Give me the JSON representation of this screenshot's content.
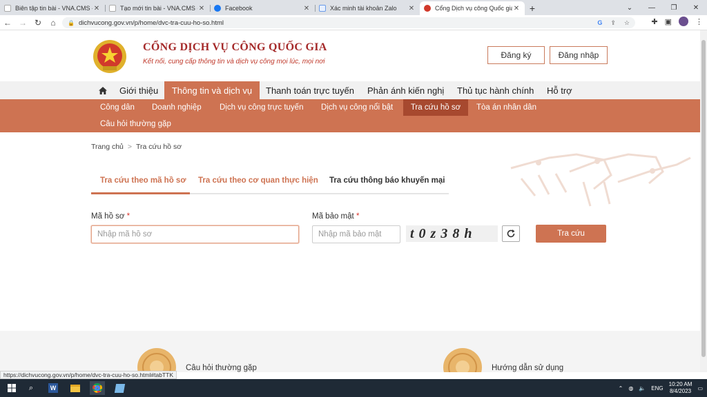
{
  "browser": {
    "tabs": [
      {
        "title": "Biên tập tin bài - VNA.CMS - BNI",
        "favicon_color": "#ffffff"
      },
      {
        "title": "Tạo mới tin bài - VNA.CMS - BNI",
        "favicon_color": "#ffffff"
      },
      {
        "title": "Facebook",
        "favicon_color": "#1877f2"
      },
      {
        "title": "Xác minh tài khoản Zalo",
        "favicon_color": "#e7f0ff"
      },
      {
        "title": "Cổng Dịch vụ công Quốc gia",
        "favicon_color": "#d1392b"
      }
    ],
    "address": "dichvucong.gov.vn/p/home/dvc-tra-cuu-ho-so.html",
    "status_url": "https://dichvucong.gov.vn/p/home/dvc-tra-cuu-ho-so.html#tabTTK"
  },
  "header": {
    "title": "CỔNG DỊCH VỤ CÔNG QUỐC GIA",
    "subtitle": "Kết nối, cung cấp thông tin và dịch vụ công mọi lúc, mọi nơi",
    "register_label": "Đăng ký",
    "login_label": "Đăng nhập"
  },
  "mainnav": [
    {
      "label": "Giới thiệu"
    },
    {
      "label": "Thông tin và dịch vụ"
    },
    {
      "label": "Thanh toán trực tuyến"
    },
    {
      "label": "Phản ánh kiến nghị"
    },
    {
      "label": "Thủ tục hành chính"
    },
    {
      "label": "Hỗ trợ"
    }
  ],
  "subnav": [
    {
      "label": "Công dân"
    },
    {
      "label": "Doanh nghiệp"
    },
    {
      "label": "Dịch vụ công trực tuyến"
    },
    {
      "label": "Dịch vụ công nổi bật"
    },
    {
      "label": "Tra cứu hồ sơ"
    },
    {
      "label": "Tòa án nhân dân"
    },
    {
      "label": "Câu hỏi thường gặp"
    }
  ],
  "breadcrumb": {
    "home": "Trang chủ",
    "current": "Tra cứu hồ sơ"
  },
  "search_tabs": [
    {
      "label": "Tra cứu theo mã hồ sơ"
    },
    {
      "label": "Tra cứu theo cơ quan thực hiện"
    },
    {
      "label": "Tra cứu thông báo khuyến mại"
    }
  ],
  "form": {
    "record_code_label": "Mã hồ sơ",
    "record_code_placeholder": "Nhập mã hồ sơ",
    "security_code_label": "Mã bảo mật",
    "security_code_placeholder": "Nhập mã bảo mật",
    "required_mark": "*",
    "captcha_text": "t0z38h",
    "submit_label": "Tra cứu"
  },
  "footer": {
    "faq_label": "Câu hỏi thường gặp",
    "guide_label": "Hướng dẫn sử dụng"
  },
  "taskbar": {
    "lang": "ENG",
    "time": "10:20 AM",
    "date": "8/4/2023"
  },
  "colors": {
    "accent": "#ce7352",
    "accent_dark": "#a7492f",
    "brand_red": "#a52a2a"
  }
}
